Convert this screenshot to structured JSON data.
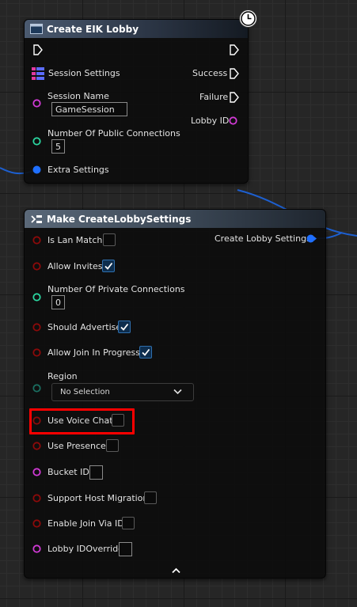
{
  "create_node": {
    "title": "Create EIK Lobby",
    "session_settings_label": "Session Settings",
    "session_name_label": "Session Name",
    "session_name_value": "GameSession",
    "public_connections_label": "Number Of Public Connections",
    "public_connections_value": "5",
    "extra_settings_label": "Extra Settings",
    "success_label": "Success",
    "failure_label": "Failure",
    "lobby_id_label": "Lobby ID"
  },
  "make_node": {
    "title": "Make CreateLobbySettings",
    "output_label": "Create Lobby Settings",
    "is_lan_match": {
      "label": "Is Lan Match",
      "checked": false
    },
    "allow_invites": {
      "label": "Allow Invites",
      "checked": true
    },
    "private_connections_label": "Number Of Private Connections",
    "private_connections_value": "0",
    "should_advertise": {
      "label": "Should Advertise",
      "checked": true
    },
    "allow_join_in_progress": {
      "label": "Allow Join In Progress",
      "checked": true
    },
    "region_label": "Region",
    "region_value": "No Selection",
    "use_voice_chat": {
      "label": "Use Voice Chat",
      "checked": false
    },
    "use_presence": {
      "label": "Use Presence",
      "checked": false
    },
    "bucket_id_label": "Bucket ID",
    "support_host_migration": {
      "label": "Support Host Migration",
      "checked": false
    },
    "enable_join_via_id": {
      "label": "Enable Join Via ID",
      "checked": false
    },
    "lobby_id_override_label": "Lobby IDOverride"
  },
  "colors": {
    "struct_pin": "#1f6fff",
    "string_pin": "#d23ad6",
    "int_pin": "#2bd6a0",
    "bool_pin": "#8c0a0a",
    "enum_pin": "#1a6e60",
    "highlight": "#ff0000"
  },
  "icons": [
    "function-icon",
    "struct-make-icon",
    "clock-icon",
    "exec-pin-icon",
    "check-icon",
    "chevron-down-icon",
    "chevron-up-icon"
  ]
}
